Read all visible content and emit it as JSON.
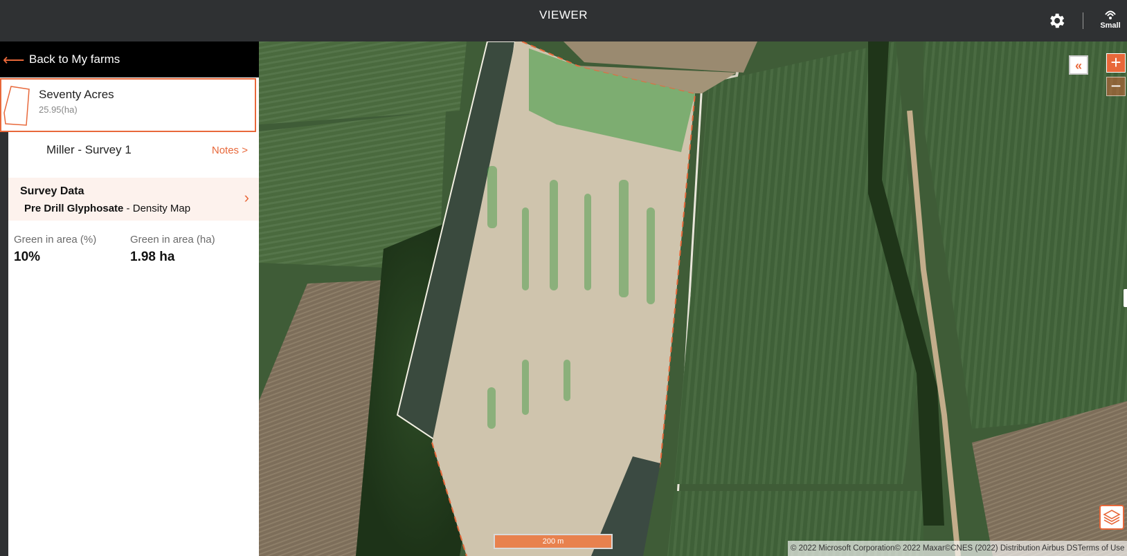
{
  "header": {
    "title": "VIEWER",
    "brand_text": "Small"
  },
  "sidebar": {
    "back_label": "Back to My farms",
    "farm": {
      "name": "Seventy Acres",
      "area": "25.95(ha)"
    },
    "survey": {
      "name": "Miller - Survey 1",
      "notes_label": "Notes >"
    },
    "survey_data": {
      "heading": "Survey Data",
      "product": "Pre Drill Glyphosate",
      "separator": " - ",
      "map_type": "Density Map"
    },
    "stats": [
      {
        "label": "Green in area (%)",
        "value": "10%"
      },
      {
        "label": "Green in area (ha)",
        "value": "1.98 ha"
      }
    ]
  },
  "map": {
    "collapse_label": "«",
    "zoom_in_label": "+",
    "zoom_out_label": "−",
    "scale_label": "200 m",
    "attribution": "© 2022 Microsoft Corporation© 2022 Maxar©CNES (2022) Distribution Airbus DSTerms of Use"
  },
  "colors": {
    "accent": "#e8683a",
    "topbar": "#2f3133",
    "back_bar": "#000000",
    "survey_data_bg": "#fdf2ed"
  },
  "icons": {
    "settings": "gear-icon",
    "back": "arrow-left-icon",
    "chevron": "chevron-right-icon",
    "layers": "layers-icon"
  }
}
